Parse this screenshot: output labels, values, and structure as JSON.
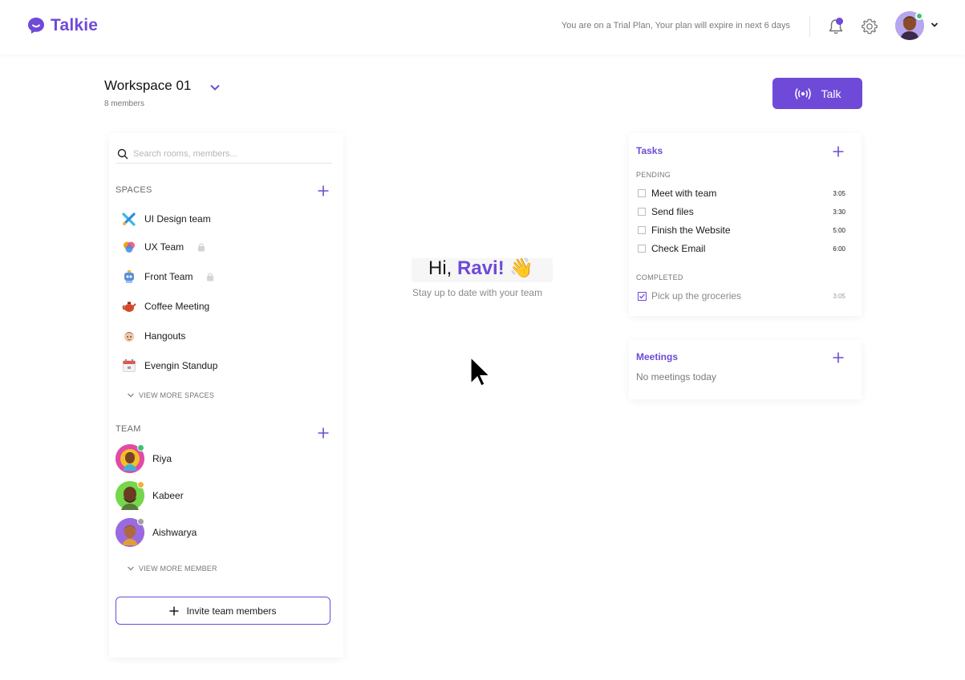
{
  "header": {
    "brand": "Talkie",
    "trial_notice": "You are on a Trial Plan, Your plan will expire in next 6 days"
  },
  "workspace": {
    "name": "Workspace 01",
    "members": "8 members",
    "talk_label": "Talk"
  },
  "sidebar": {
    "search_placeholder": "Search rooms, members...",
    "spaces_label": "SPACES",
    "spaces": [
      {
        "label": "UI Design team",
        "icon": "tools-icon",
        "locked": false
      },
      {
        "label": "UX Team",
        "icon": "color-wheel-icon",
        "locked": true
      },
      {
        "label": "Front Team",
        "icon": "robot-icon",
        "locked": true
      },
      {
        "label": "Coffee Meeting",
        "icon": "teapot-icon",
        "locked": false
      },
      {
        "label": "Hangouts",
        "icon": "face-icon",
        "locked": false
      },
      {
        "label": "Evengin Standup",
        "icon": "calendar-icon",
        "locked": false
      }
    ],
    "view_more_spaces": "VIEW MORE SPACES",
    "team_label": "TEAM",
    "members": [
      {
        "name": "Riya",
        "status_color": "#3cc36b"
      },
      {
        "name": "Kabeer",
        "status_color": "#f2b233"
      },
      {
        "name": "Aishwarya",
        "status_color": "#a0a0a0"
      }
    ],
    "view_more_members": "VIEW MORE MEMBER",
    "invite_label": "Invite team members"
  },
  "greeting": {
    "hi": "Hi,",
    "name": "Ravi!",
    "emoji": "👋",
    "subtitle": "Stay up to date with your team"
  },
  "tasks": {
    "title": "Tasks",
    "pending_label": "PENDING",
    "pending": [
      {
        "label": "Meet with team",
        "time": "3:05"
      },
      {
        "label": "Send files",
        "time": "3:30"
      },
      {
        "label": "Finish the Website",
        "time": "5:00"
      },
      {
        "label": "Check Email",
        "time": "6:00"
      }
    ],
    "completed_label": "COMPLETED",
    "completed": [
      {
        "label": "Pick up the groceries",
        "time": "3:05"
      }
    ]
  },
  "meetings": {
    "title": "Meetings",
    "empty": "No meetings today"
  },
  "colors": {
    "accent": "#6f4ad8",
    "online": "#3cc36b",
    "away": "#f2b233",
    "offline": "#a0a0a0"
  }
}
